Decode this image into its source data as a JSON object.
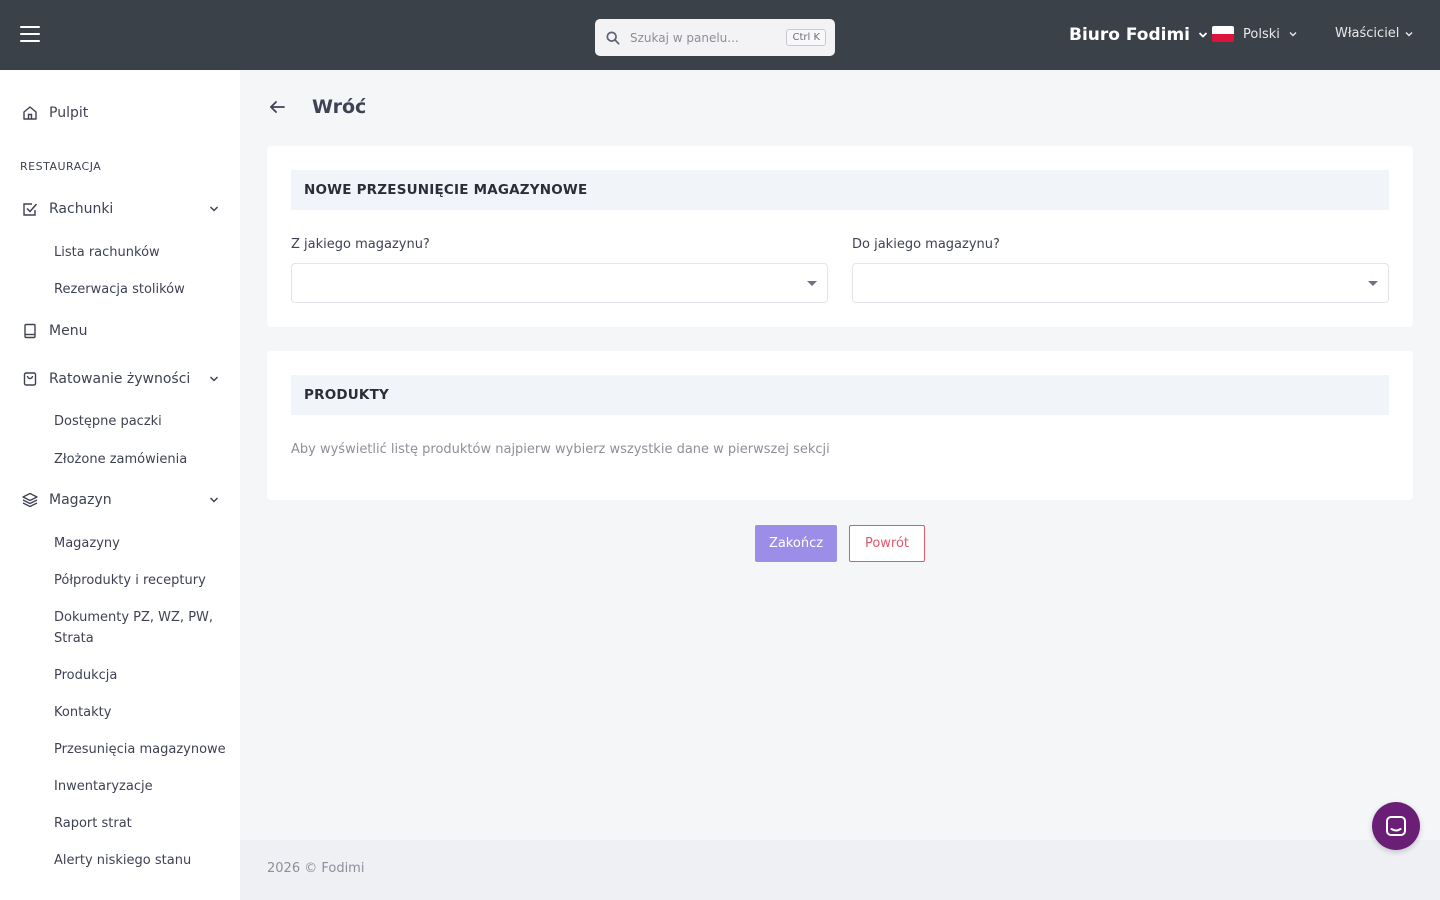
{
  "topbar": {
    "search_placeholder": "Szukaj w panelu...",
    "search_shortcut": "Ctrl K",
    "company": "Biuro Fodimi",
    "language": "Polski",
    "user": "Właściciel"
  },
  "sidebar": {
    "dashboard": "Pulpit",
    "section": "RESTAURACJA",
    "bills": {
      "label": "Rachunki",
      "items": [
        "Lista rachunków",
        "Rezerwacja stolików"
      ]
    },
    "menu": "Menu",
    "food_rescue": {
      "label": "Ratowanie żywności",
      "items": [
        "Dostępne paczki",
        "Złożone zamówienia"
      ]
    },
    "warehouse": {
      "label": "Magazyn",
      "items": [
        "Magazyny",
        "Półprodukty i receptury",
        "Dokumenty PZ, WZ, PW, Strata",
        "Produkcja",
        "Kontakty",
        "Przesunięcia magazynowe",
        "Inwentaryzacje",
        "Raport strat",
        "Alerty niskiego stanu"
      ]
    }
  },
  "page": {
    "back_label": "Wróć",
    "transfer_card": {
      "title": "NOWE PRZESUNIĘCIE MAGAZYNOWE",
      "from_label": "Z jakiego magazynu?",
      "from_value": "",
      "to_label": "Do jakiego magazynu?",
      "to_value": ""
    },
    "products_card": {
      "title": "PRODUKTY",
      "hint": "Aby wyświetlić listę produktów najpierw wybierz wszystkie dane w pierwszej sekcji"
    },
    "finish_button": "Zakończ",
    "return_button": "Powrót"
  },
  "footer": {
    "text": "2026 © Fodimi"
  },
  "colors": {
    "topbar": "#3b4149",
    "primary": "#9c8ee8",
    "danger": "#e05a6c",
    "chat": "#6b1e75"
  }
}
